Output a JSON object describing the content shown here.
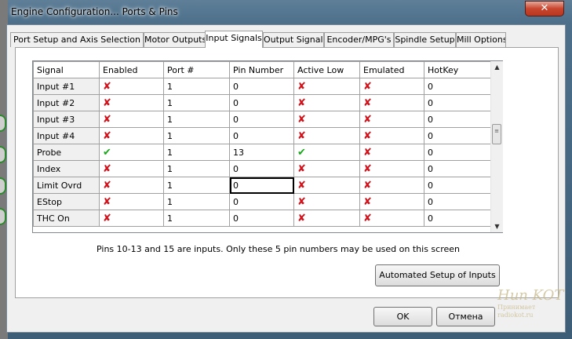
{
  "window": {
    "title": "Engine Configuration... Ports & Pins",
    "close_glyph": "✕"
  },
  "tabs": [
    {
      "label": "Port Setup and Axis Selection",
      "active": false
    },
    {
      "label": "Motor Outputs",
      "active": false
    },
    {
      "label": "Input Signals",
      "active": true
    },
    {
      "label": "Output Signals",
      "active": false
    },
    {
      "label": "Encoder/MPG's",
      "active": false
    },
    {
      "label": "Spindle Setup",
      "active": false
    },
    {
      "label": "Mill Options",
      "active": false
    }
  ],
  "grid": {
    "columns": [
      "Signal",
      "Enabled",
      "Port #",
      "Pin Number",
      "Active Low",
      "Emulated",
      "HotKey"
    ],
    "rows": [
      {
        "signal": "Input #1",
        "enabled": false,
        "port": "1",
        "pin": "0",
        "active_low": false,
        "emulated": false,
        "hotkey": "0"
      },
      {
        "signal": "Input #2",
        "enabled": false,
        "port": "1",
        "pin": "0",
        "active_low": false,
        "emulated": false,
        "hotkey": "0"
      },
      {
        "signal": "Input #3",
        "enabled": false,
        "port": "1",
        "pin": "0",
        "active_low": false,
        "emulated": false,
        "hotkey": "0"
      },
      {
        "signal": "Input #4",
        "enabled": false,
        "port": "1",
        "pin": "0",
        "active_low": false,
        "emulated": false,
        "hotkey": "0"
      },
      {
        "signal": "Probe",
        "enabled": true,
        "port": "1",
        "pin": "13",
        "active_low": true,
        "emulated": false,
        "hotkey": "0"
      },
      {
        "signal": "Index",
        "enabled": false,
        "port": "1",
        "pin": "0",
        "active_low": false,
        "emulated": false,
        "hotkey": "0"
      },
      {
        "signal": "Limit Ovrd",
        "enabled": false,
        "port": "1",
        "pin": "0",
        "active_low": false,
        "emulated": false,
        "hotkey": "0",
        "selected_cell": "pin"
      },
      {
        "signal": "EStop",
        "enabled": false,
        "port": "1",
        "pin": "0",
        "active_low": false,
        "emulated": false,
        "hotkey": "0"
      },
      {
        "signal": "THC On",
        "enabled": false,
        "port": "1",
        "pin": "0",
        "active_low": false,
        "emulated": false,
        "hotkey": "0"
      }
    ],
    "icons": {
      "true": "check-icon",
      "false": "red-x-icon"
    }
  },
  "note": "Pins 10-13 and 15 are inputs. Only these 5 pin numbers may be used on this screen",
  "buttons": {
    "auto_setup": "Automated Setup of Inputs",
    "ok": "OK",
    "cancel": "Отмена"
  },
  "watermark": {
    "line1": "Hun KOT",
    "line2": "Принимает",
    "line3": "radiokot.ru"
  },
  "colors": {
    "x_mark": "#d0121b",
    "check": "#18a818",
    "title_bar": "#4d6f8a",
    "close": "#c9452e"
  }
}
